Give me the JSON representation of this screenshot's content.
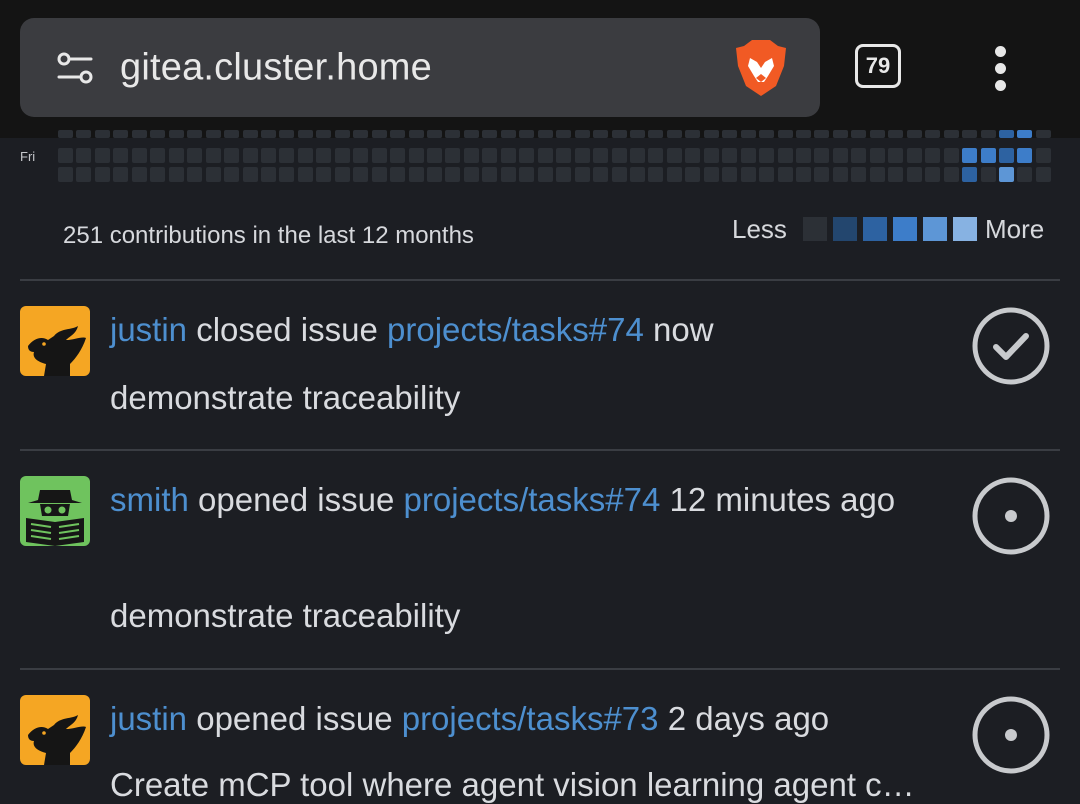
{
  "browser": {
    "url": "gitea.cluster.home",
    "tab_count": "79",
    "icons": [
      "site-settings-icon",
      "brave-lion-icon",
      "overflow-menu-icon"
    ]
  },
  "heatmap": {
    "row_label": "Fri",
    "summary": "251 contributions in the last 12 months",
    "legend_less": "Less",
    "legend_more": "More",
    "legend_colors": [
      "#2c3036",
      "#23466e",
      "#2d62a1",
      "#3d7dc9",
      "#5d96d6",
      "#87b2e2"
    ],
    "empty_color": "#2c3036"
  },
  "feed": [
    {
      "user": "justin",
      "action": "closed issue",
      "issue": "projects/tasks#74",
      "time": "now",
      "description": "demonstrate traceability",
      "status_icon": "issue-closed-check-icon",
      "avatar": "eagle-avatar"
    },
    {
      "user": "smith",
      "action": "opened issue",
      "issue": "projects/tasks#74",
      "time": "12 minutes ago",
      "description": "demonstrate traceability",
      "status_icon": "issue-opened-icon",
      "avatar": "spy-newspaper-avatar"
    },
    {
      "user": "justin",
      "action": "opened issue",
      "issue": "projects/tasks#73",
      "time": "2 days ago",
      "description": "Create mCP tool where agent vision learning agent c…",
      "status_icon": "issue-opened-icon",
      "avatar": "eagle-avatar"
    }
  ]
}
